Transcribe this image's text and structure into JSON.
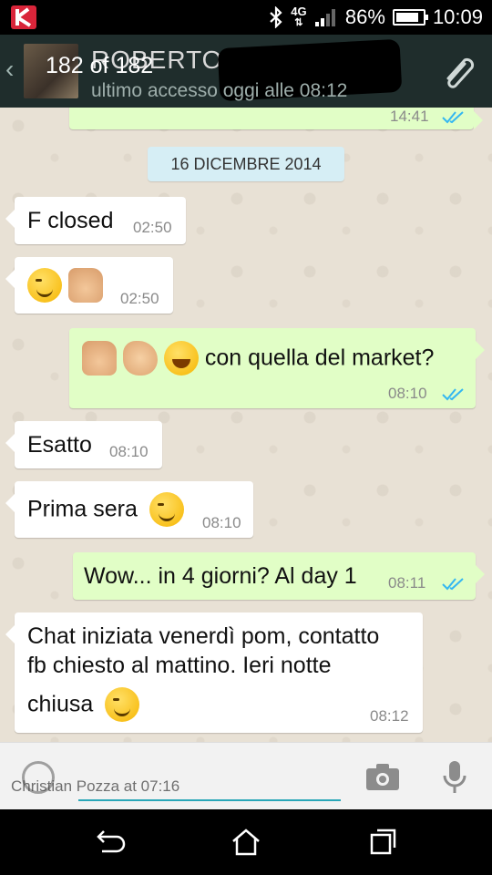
{
  "status_bar": {
    "network": "4G",
    "battery": "86%",
    "time": "10:09",
    "battery_level": 0.86
  },
  "header": {
    "contact_name": "ROBERTO C",
    "last_seen": "ultimo accesso oggi alle 08:12",
    "match_counter": "182 of 182"
  },
  "chat": {
    "prev_time": "14:41",
    "date_chip": "16 DICEMBRE 2014",
    "messages": [
      {
        "dir": "in",
        "text": "F closed",
        "time": "02:50"
      },
      {
        "dir": "in",
        "text": "",
        "emojis": [
          "wink",
          "thumbs-up"
        ],
        "time": "02:50"
      },
      {
        "dir": "out",
        "text": "con quella del market?",
        "emojis": [
          "thumbs-up",
          "clapping-hands",
          "tears-of-joy"
        ],
        "time": "08:10"
      },
      {
        "dir": "in",
        "text": "Esatto",
        "time": "08:10"
      },
      {
        "dir": "in",
        "text": "Prima sera",
        "emojis": [
          "wink"
        ],
        "time": "08:10"
      },
      {
        "dir": "out",
        "text": "Wow... in 4 giorni? Al day 1",
        "time": "08:11"
      },
      {
        "dir": "in",
        "lines": [
          "Chat iniziata venerdì pom, contatto",
          "fb chiesto al mattino. Ieri notte",
          "chiusa"
        ],
        "emojis": [
          "wink"
        ],
        "time": "08:12"
      }
    ]
  },
  "input": {
    "watermark": "Christian Pozza at 07:16"
  },
  "colors": {
    "header_bg": "#1f2d2c",
    "out_bubble": "#e1fec6",
    "in_bubble": "#ffffff",
    "read_ticks": "#34b7f1",
    "date_chip": "#d6eef5"
  }
}
